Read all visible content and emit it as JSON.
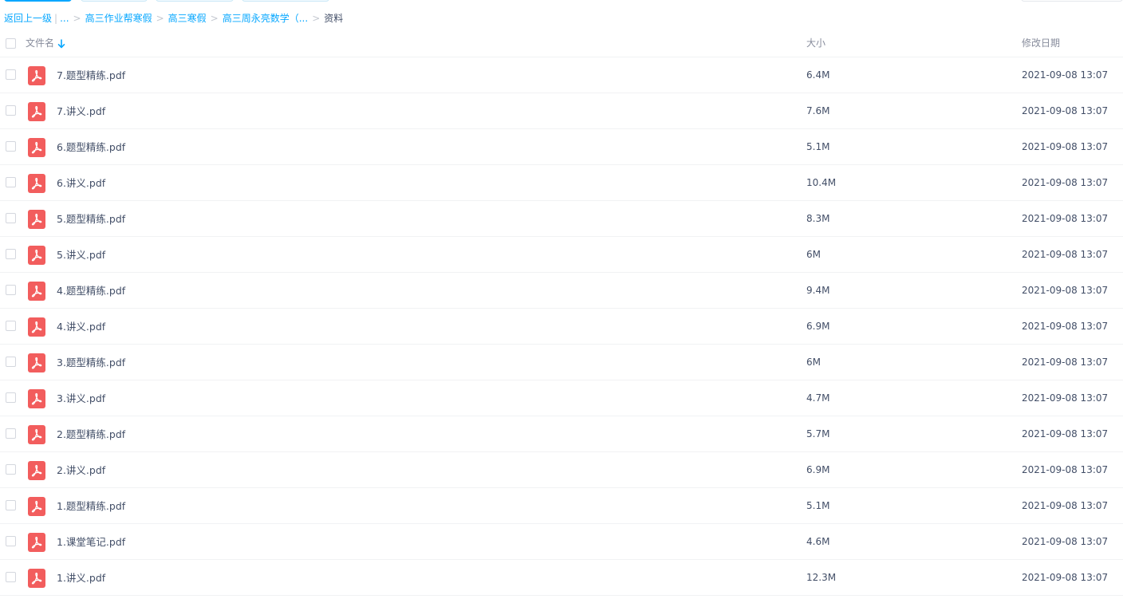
{
  "breadcrumb": {
    "back": "返回上一级",
    "ellipsis": "...",
    "items": [
      "高三作业帮寒假",
      "高三寒假",
      "高三周永亮数学（..."
    ],
    "current": "资料"
  },
  "header": {
    "name": "文件名",
    "size": "大小",
    "date": "修改日期"
  },
  "icons": {
    "file": "pdf-file-icon",
    "sort": "sort-arrow-down-icon"
  },
  "colors": {
    "accent": "#06a7ff",
    "pdf": "#f25d5d"
  },
  "files": [
    {
      "name": "7.题型精练.pdf",
      "size": "6.4M",
      "date": "2021-09-08 13:07"
    },
    {
      "name": "7.讲义.pdf",
      "size": "7.6M",
      "date": "2021-09-08 13:07"
    },
    {
      "name": "6.题型精练.pdf",
      "size": "5.1M",
      "date": "2021-09-08 13:07"
    },
    {
      "name": "6.讲义.pdf",
      "size": "10.4M",
      "date": "2021-09-08 13:07"
    },
    {
      "name": "5.题型精练.pdf",
      "size": "8.3M",
      "date": "2021-09-08 13:07"
    },
    {
      "name": "5.讲义.pdf",
      "size": "6M",
      "date": "2021-09-08 13:07"
    },
    {
      "name": "4.题型精练.pdf",
      "size": "9.4M",
      "date": "2021-09-08 13:07"
    },
    {
      "name": "4.讲义.pdf",
      "size": "6.9M",
      "date": "2021-09-08 13:07"
    },
    {
      "name": "3.题型精练.pdf",
      "size": "6M",
      "date": "2021-09-08 13:07"
    },
    {
      "name": "3.讲义.pdf",
      "size": "4.7M",
      "date": "2021-09-08 13:07"
    },
    {
      "name": "2.题型精练.pdf",
      "size": "5.7M",
      "date": "2021-09-08 13:07"
    },
    {
      "name": "2.讲义.pdf",
      "size": "6.9M",
      "date": "2021-09-08 13:07"
    },
    {
      "name": "1.题型精练.pdf",
      "size": "5.1M",
      "date": "2021-09-08 13:07"
    },
    {
      "name": "1.课堂笔记.pdf",
      "size": "4.6M",
      "date": "2021-09-08 13:07"
    },
    {
      "name": "1.讲义.pdf",
      "size": "12.3M",
      "date": "2021-09-08 13:07"
    }
  ]
}
